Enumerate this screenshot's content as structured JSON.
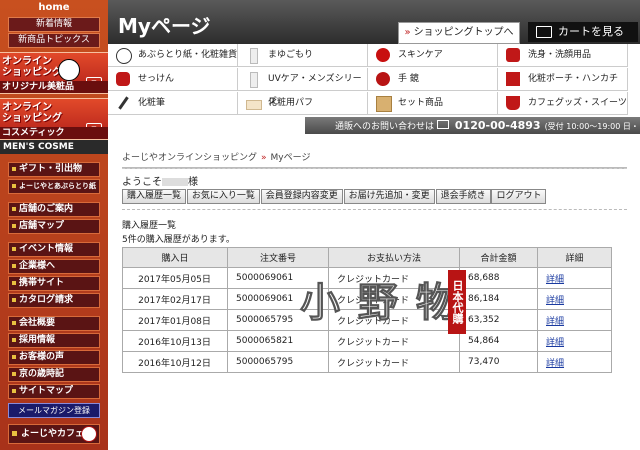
{
  "sidebar": {
    "home": "home",
    "top_links": [
      "新着情報",
      "新商品トピックス"
    ],
    "promo1": {
      "line1": "オンライン",
      "line2": "ショッピング",
      "bar": "オリジナル美粧品"
    },
    "promo2": {
      "line1": "オンライン",
      "line2": "ショッピング",
      "bar": "コスメティック"
    },
    "mens": "MEN'S COSME",
    "group1": [
      "ギフト・引出物",
      "よーじやとあぶらとり紙"
    ],
    "group2": [
      "店舗のご案内",
      "店舗マップ"
    ],
    "group3": [
      "イベント情報",
      "企業様へ",
      "携帯サイト",
      "カタログ請求"
    ],
    "group4": [
      "会社概要",
      "採用情報",
      "お客様の声",
      "京の歳時記",
      "サイトマップ"
    ],
    "mail": "メールマガジン登録",
    "cafe": "よーじやカフェ"
  },
  "header": {
    "title": "Myページ",
    "shop_top": "ショッピングトップへ",
    "cart": "カートを見る"
  },
  "categories": [
    {
      "label": "あぶらとり紙・化粧雑貨",
      "icon": "face-icon"
    },
    {
      "label": "まゆごもり",
      "icon": "bottle-icon"
    },
    {
      "label": "スキンケア",
      "icon": "cream-icon"
    },
    {
      "label": "洗身・洗顔用品",
      "icon": "pouch-icon"
    },
    {
      "label": "せっけん",
      "icon": "soap-icon"
    },
    {
      "label": "UVケア・メンズシリーズ",
      "icon": "tube-icon"
    },
    {
      "label": "手 鏡",
      "icon": "mirror-icon"
    },
    {
      "label": "化粧ポーチ・ハンカチ",
      "icon": "bag-icon"
    },
    {
      "label": "化粧筆",
      "icon": "brush-icon"
    },
    {
      "label": "化粧用パフ",
      "icon": "puff-icon"
    },
    {
      "label": "セット商品",
      "icon": "gift-icon"
    },
    {
      "label": "カフェグッズ・スイーツ",
      "icon": "cup-icon"
    }
  ],
  "contact": {
    "label": "通販へのお問い合わせは",
    "number": "0120-00-4893",
    "hours": "(受付 10:00〜19:00 日・祝休)"
  },
  "breadcrumb": {
    "home": "よーじやオンラインショッピング",
    "current": "Myページ"
  },
  "welcome": {
    "prefix": "ようこそ",
    "suffix": "様"
  },
  "tabs": [
    "購入履歴一覧",
    "お気に入り一覧",
    "会員登録内容変更",
    "お届け先追加・変更",
    "退会手続き",
    "ログアウト"
  ],
  "history": {
    "title": "購入履歴一覧",
    "count_text": "5件の購入履歴があります。",
    "headers": [
      "購入日",
      "注文番号",
      "お支払い方法",
      "合計金額",
      "詳細"
    ],
    "rows": [
      {
        "date": "2017年05月05日",
        "order": "5000069061",
        "payment": "クレジットカード",
        "total": "68,688",
        "detail": "詳細"
      },
      {
        "date": "2017年02月17日",
        "order": "5000069061",
        "payment": "クレジットカード",
        "total": "86,184",
        "detail": "詳細"
      },
      {
        "date": "2017年01月08日",
        "order": "5000065795",
        "payment": "クレジットカード",
        "total": "63,352",
        "detail": "詳細"
      },
      {
        "date": "2016年10月13日",
        "order": "5000065821",
        "payment": "クレジットカード",
        "total": "54,864",
        "detail": "詳細"
      },
      {
        "date": "2016年10月12日",
        "order": "5000065795",
        "payment": "クレジットカード",
        "total": "73,470",
        "detail": "詳細"
      }
    ]
  },
  "watermark": {
    "text": "小 野 物",
    "stamp": "日本代購"
  },
  "colors": {
    "sidebar": "#b83a1c",
    "header": "#3a3a3a",
    "link": "#1a3aa0",
    "accent": "#c02020"
  }
}
